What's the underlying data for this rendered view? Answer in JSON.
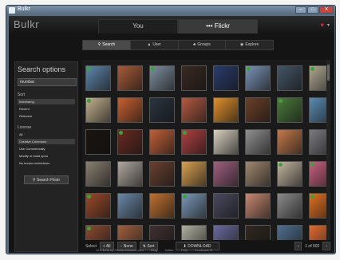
{
  "window": {
    "title": "Bulkr",
    "min_label": "─",
    "max_label": "□",
    "close_label": "✕"
  },
  "app": {
    "logo": "Bulkr"
  },
  "tabs": [
    {
      "label": "You"
    },
    {
      "label": "••• Flickr"
    }
  ],
  "header_icons": {
    "heart": "♥",
    "menu": "▾"
  },
  "subnav": [
    {
      "label": "Search",
      "icon": "search-icon"
    },
    {
      "label": "User",
      "icon": "user-icon"
    },
    {
      "label": "Groups",
      "icon": "groups-icon"
    },
    {
      "label": "Explore",
      "icon": "explore-icon"
    }
  ],
  "sidebar": {
    "title": "Search options",
    "search_value": "mumbai",
    "sort_heading": "Sort",
    "sort_options": [
      "Interesting",
      "Recent",
      "Relevant"
    ],
    "license_heading": "License",
    "license_options": [
      "All",
      "Creative Commons",
      "Use Commercially",
      "Modify or build upon",
      "No known restrictions"
    ],
    "search_button": "Search Flickr"
  },
  "grid": {
    "thumbnail_colors": [
      "#5f86ad",
      "#a85a3a",
      "#7e8ea0",
      "#3a2a20",
      "#2a3c6e",
      "#7a93b6",
      "#445566",
      "#b0a890",
      "#c2b090",
      "#c86030",
      "#2a3440",
      "#b45a42",
      "#e0902a",
      "#6a4028",
      "#4a7a3a",
      "#5a8ab0",
      "#1a1410",
      "#6a2a20",
      "#c06038",
      "#b04040",
      "#d8d0c0",
      "#909090",
      "#c4784a",
      "#7a7a80",
      "#8a7f70",
      "#b0a8a0",
      "#6a4030",
      "#d8a050",
      "#a06080",
      "#a08870",
      "#c4b4a0",
      "#c86080",
      "#9a4a2a",
      "#6a88a8",
      "#c07030",
      "#7a98b8",
      "#4a4a60",
      "#c88870",
      "#8a8a8a",
      "#e07020",
      "#8a4a30",
      "#a06040",
      "#403030",
      "#b0b0a0",
      "#6a6aa0",
      "#302820",
      "#507090",
      "#e06a30"
    ],
    "checked": [
      0,
      2,
      5,
      7,
      8,
      14,
      17,
      19,
      30,
      31,
      32,
      35,
      39,
      40
    ]
  },
  "footer": {
    "select_label": "Select",
    "buttons": [
      {
        "label": "+ All"
      },
      {
        "label": "− None"
      },
      {
        "label": "⇅ Sort"
      }
    ],
    "download_label": "⬇ DOWNLOAD",
    "prev": "‹",
    "page": "1 of 502",
    "next": "›"
  },
  "credits": [
    "v0.6 Beta by ©BulkrSoftware.com",
    "Blog",
    "Twitter",
    "FAQ",
    "Feedback ✉"
  ]
}
